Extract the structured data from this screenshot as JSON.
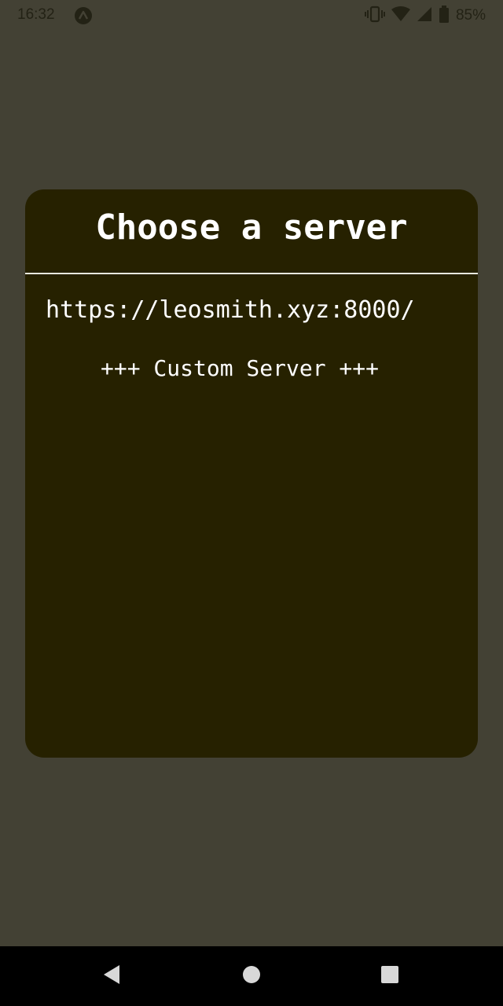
{
  "status_bar": {
    "time": "16:32",
    "app_icon": "a-launcher-icon",
    "vibrate_icon": "vibrate-icon",
    "wifi_icon": "wifi-icon",
    "signal_icon": "signal-icon",
    "battery_icon": "battery-icon",
    "battery_percent": "85%"
  },
  "dialog": {
    "title": "Choose a server",
    "servers": [
      {
        "label": "https://leosmith.xyz:8000/"
      }
    ],
    "custom_server_label": "+++ Custom Server +++"
  },
  "nav_bar": {
    "back_icon": "back-triangle-icon",
    "home_icon": "home-circle-icon",
    "recents_icon": "recents-square-icon"
  },
  "colors": {
    "background": "#434134",
    "dialog": "#262100",
    "text": "#ffffff",
    "nav_bar": "#000000"
  }
}
